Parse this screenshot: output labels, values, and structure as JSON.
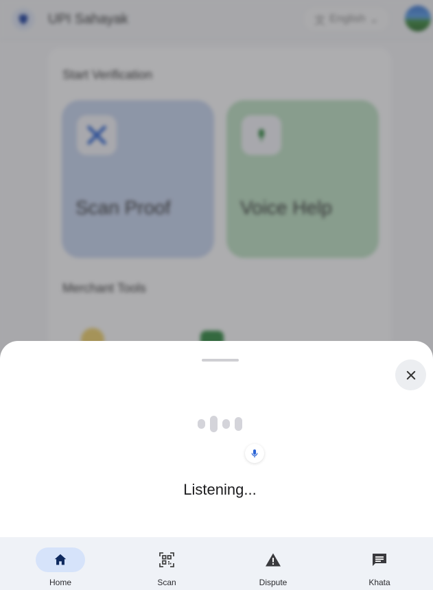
{
  "header": {
    "app_title": "UPI Sahayak",
    "language": "English",
    "logo_icon": "shield-icon",
    "language_icon": "translate-icon"
  },
  "sections": {
    "start_verification": "Start Verification",
    "merchant_tools": "Merchant Tools"
  },
  "tiles": [
    {
      "label": "Scan Proof",
      "icon": "scan-icon",
      "color": "#c9d7f1"
    },
    {
      "label": "Voice Help",
      "icon": "mic-icon",
      "color": "#bfe3c4"
    }
  ],
  "voice_sheet": {
    "status": "Listening...",
    "close_icon": "close-icon",
    "mic_icon": "mic-icon"
  },
  "nav": {
    "items": [
      {
        "label": "Home",
        "icon": "home-icon",
        "active": true
      },
      {
        "label": "Scan",
        "icon": "qr-scan-icon",
        "active": false
      },
      {
        "label": "Dispute",
        "icon": "warning-icon",
        "active": false
      },
      {
        "label": "Khata",
        "icon": "message-icon",
        "active": false
      }
    ]
  },
  "colors": {
    "accent": "#1a3a7a",
    "nav_active_pill": "#d6e3fa",
    "mic_blue": "#2b64d6"
  }
}
